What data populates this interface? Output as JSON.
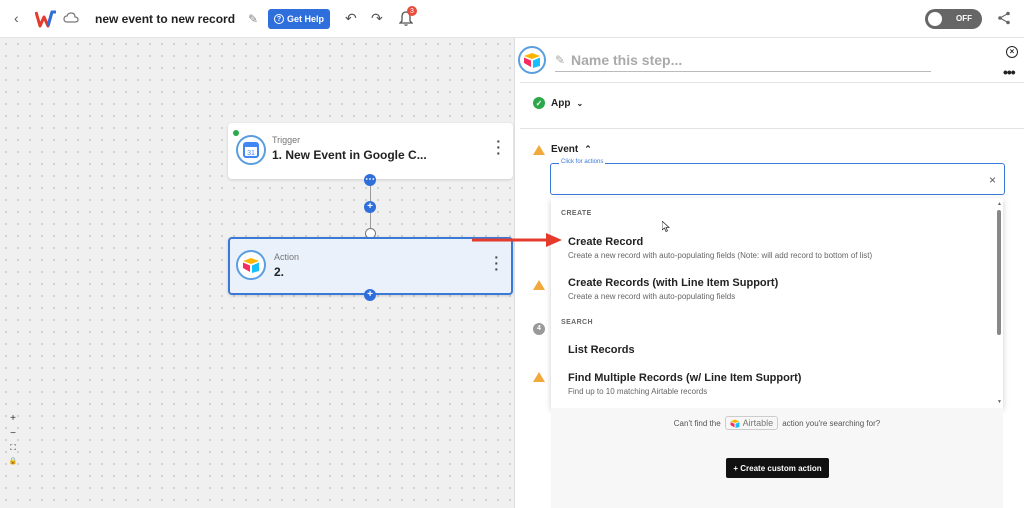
{
  "topbar": {
    "workflow_title": "new event to new record",
    "get_help_label": "Get Help",
    "notification_count": "3",
    "toggle_label": "OFF"
  },
  "canvas": {
    "trigger": {
      "type": "Trigger",
      "name": "1. New Event in Google C..."
    },
    "action": {
      "type": "Action",
      "name": "2."
    },
    "zoom_controls": [
      "+",
      "−",
      "⛶",
      "🔒"
    ]
  },
  "panel": {
    "name_placeholder": "Name this step...",
    "app_label": "App",
    "event_label": "Event",
    "event_input_placeholder": "Click for actions",
    "step_number": "4",
    "dropdown": {
      "group_create": "CREATE",
      "group_search": "SEARCH",
      "items": [
        {
          "title": "Create Record",
          "desc": "Create a new record with auto-populating fields (Note: will add record to bottom of list)"
        },
        {
          "title": "Create Records (with Line Item Support)",
          "desc": "Create a new record with auto-populating fields"
        },
        {
          "title": "List Records",
          "desc": ""
        },
        {
          "title": "Find Multiple Records (w/ Line Item Support)",
          "desc": "Find up to 10 matching Airtable records"
        }
      ]
    },
    "cant_find_prefix": "Can't find the",
    "app_chip": "Airtable",
    "cant_find_suffix": "action you're searching for?",
    "custom_action_label": "+ Create custom action"
  },
  "colors": {
    "accent": "#2f6fdc",
    "success": "#2ba84a",
    "warning": "#f2a93b",
    "arrow": "#e53b2c"
  }
}
